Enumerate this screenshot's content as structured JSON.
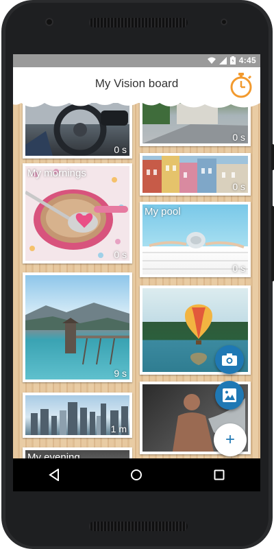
{
  "status": {
    "time": "4:45"
  },
  "appbar": {
    "title": "My Vision board"
  },
  "cards": [
    {
      "label": "",
      "duration": "0 s"
    },
    {
      "label": "",
      "duration": "0 s"
    },
    {
      "label": "My mornings",
      "duration": "0 s"
    },
    {
      "label": "",
      "duration": "0 s"
    },
    {
      "label": "My pool",
      "duration": "0 s"
    },
    {
      "label": "",
      "duration": "9 s"
    },
    {
      "label": "",
      "duration": ""
    },
    {
      "label": "",
      "duration": "1 m"
    },
    {
      "label": "",
      "duration": ""
    },
    {
      "label": "My evening",
      "duration": ""
    }
  ],
  "fabs": {
    "add_symbol": "+"
  },
  "icons": [
    "timer-icon",
    "camera-icon",
    "photo-icon",
    "add-icon",
    "back-icon",
    "home-icon",
    "recents-icon",
    "wifi-icon",
    "signal-icon",
    "battery-icon"
  ],
  "colors": {
    "accent": "#f29a2e",
    "fab_blue": "#1f78b4",
    "wood": "#e2c39a"
  }
}
